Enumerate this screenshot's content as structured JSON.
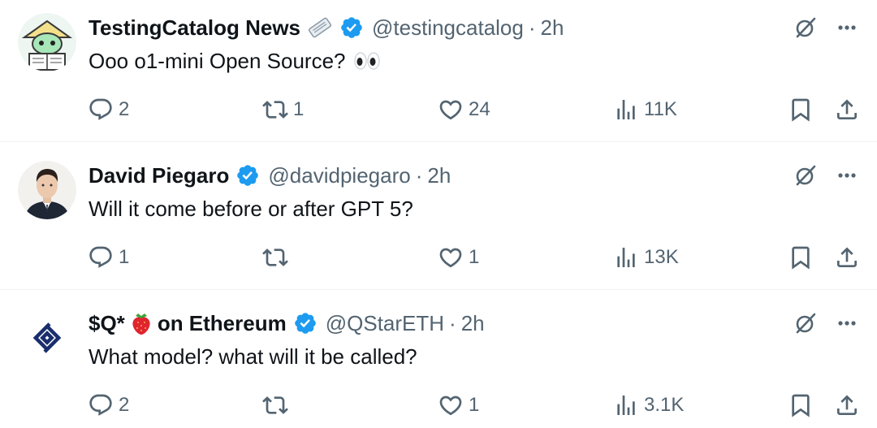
{
  "tweets": [
    {
      "name": "TestingCatalog News",
      "handle": "@testingcatalog",
      "separator": "·",
      "time": "2h",
      "text": "Ooo o1-mini Open Source?",
      "stats": {
        "replies": "2",
        "reposts": "1",
        "likes": "24",
        "views": "11K"
      },
      "icons": {
        "emoji": "newspaper-emoji",
        "trailing": "eyes-emoji"
      }
    },
    {
      "name": "David Piegaro",
      "handle": "@davidpiegaro",
      "separator": "·",
      "time": "2h",
      "text": "Will it come before or after GPT 5?",
      "stats": {
        "replies": "1",
        "reposts": "",
        "likes": "1",
        "views": "13K"
      }
    },
    {
      "name_prefix": "$Q*",
      "name_suffix": "on Ethereum",
      "handle": "@QStarETH",
      "separator": "·",
      "time": "2h",
      "text": "What model? what will it be called?",
      "stats": {
        "replies": "2",
        "reposts": "",
        "likes": "1",
        "views": "3.1K"
      },
      "icons": {
        "emoji": "strawberry-emoji"
      }
    }
  ],
  "colors": {
    "text_primary": "#0f1419",
    "text_secondary": "#536471",
    "verified": "#1d9bf0",
    "divider": "#eff3f4"
  }
}
